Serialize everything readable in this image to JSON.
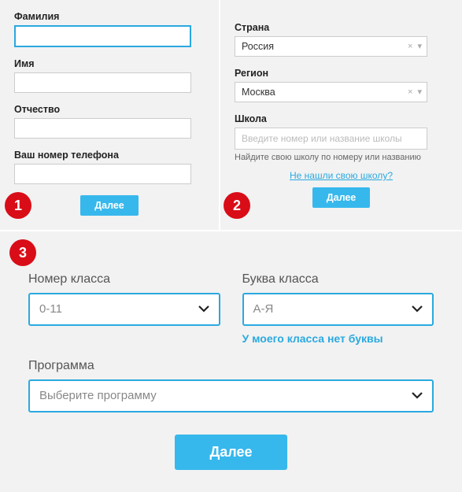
{
  "step1": {
    "badge": "1",
    "surname_label": "Фамилия",
    "name_label": "Имя",
    "patronymic_label": "Отчество",
    "phone_label": "Ваш номер телефона",
    "next_label": "Далее"
  },
  "step2": {
    "badge": "2",
    "country_label": "Страна",
    "country_value": "Россия",
    "region_label": "Регион",
    "region_value": "Москва",
    "school_label": "Школа",
    "school_placeholder": "Введите номер или название школы",
    "school_hint": "Найдите свою школу по номеру или названию",
    "not_found_link": "Не нашли свою школу?",
    "next_label": "Далее"
  },
  "step3": {
    "badge": "3",
    "class_number_label": "Номер класса",
    "class_number_value": "0-11",
    "class_letter_label": "Буква класса",
    "class_letter_value": "А-Я",
    "no_letter_link": "У моего класса нет буквы",
    "program_label": "Программа",
    "program_value": "Выберите программу",
    "next_label": "Далее"
  }
}
